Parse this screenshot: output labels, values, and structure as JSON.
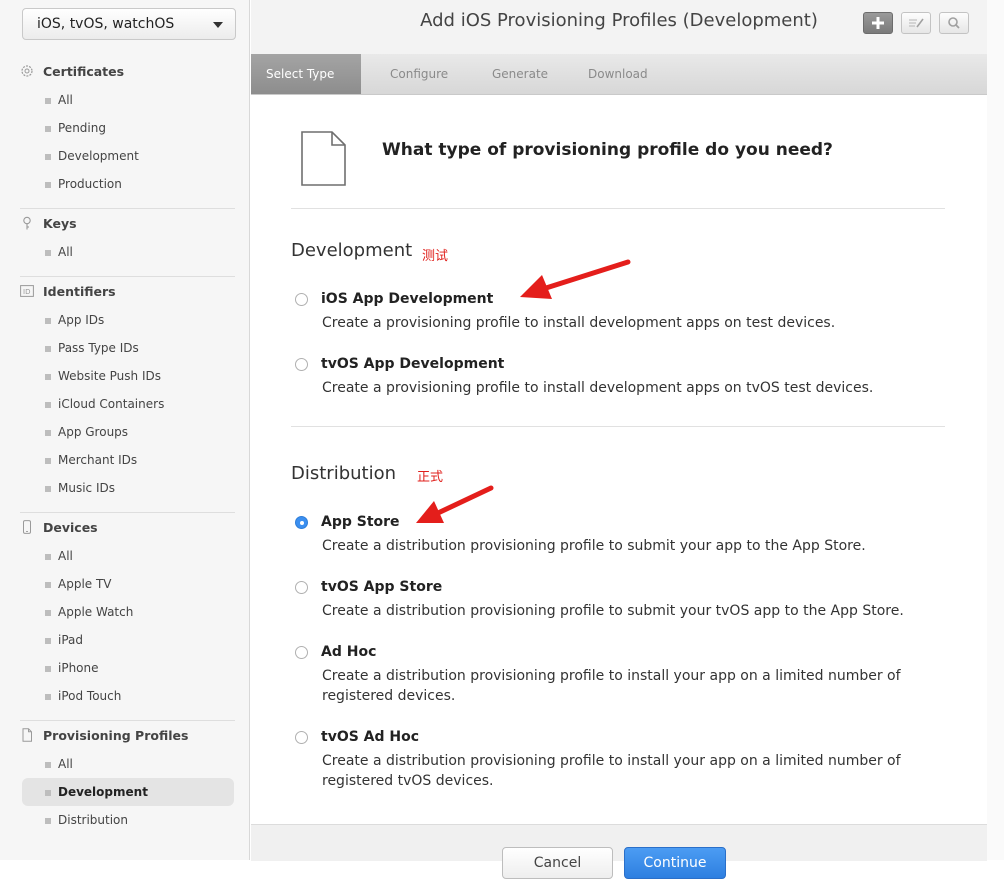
{
  "platform": {
    "selected": "iOS, tvOS, watchOS"
  },
  "sidebar": {
    "sections": [
      {
        "title": "Certificates",
        "icon": "gear-icon",
        "items": [
          "All",
          "Pending",
          "Development",
          "Production"
        ]
      },
      {
        "title": "Keys",
        "icon": "key-icon",
        "items": [
          "All"
        ]
      },
      {
        "title": "Identifiers",
        "icon": "id-icon",
        "items": [
          "App IDs",
          "Pass Type IDs",
          "Website Push IDs",
          "iCloud Containers",
          "App Groups",
          "Merchant IDs",
          "Music IDs"
        ]
      },
      {
        "title": "Devices",
        "icon": "device-icon",
        "items": [
          "All",
          "Apple TV",
          "Apple Watch",
          "iPad",
          "iPhone",
          "iPod Touch"
        ]
      },
      {
        "title": "Provisioning Profiles",
        "icon": "document-icon",
        "items": [
          "All",
          "Development",
          "Distribution"
        ],
        "active": "Development"
      }
    ]
  },
  "header": {
    "title": "Add iOS Provisioning Profiles (Development)"
  },
  "steps": [
    "Select Type",
    "Configure",
    "Generate",
    "Download"
  ],
  "main": {
    "question": "What type of provisioning profile do you need?",
    "groups": [
      {
        "title": "Development",
        "annotation": "测试",
        "options": [
          {
            "title": "iOS App Development",
            "desc": "Create a provisioning profile to install development apps on test devices.",
            "checked": false
          },
          {
            "title": "tvOS App Development",
            "desc": "Create a provisioning profile to install development apps on tvOS test devices.",
            "checked": false
          }
        ]
      },
      {
        "title": "Distribution",
        "annotation": "正式",
        "options": [
          {
            "title": "App Store",
            "desc": "Create a distribution provisioning profile to submit your app to the App Store.",
            "checked": true
          },
          {
            "title": "tvOS App Store",
            "desc": "Create a distribution provisioning profile to submit your tvOS app to the App Store.",
            "checked": false
          },
          {
            "title": "Ad Hoc",
            "desc": "Create a distribution provisioning profile to install your app on a limited number of registered devices.",
            "checked": false
          },
          {
            "title": "tvOS Ad Hoc",
            "desc": "Create a distribution provisioning profile to install your app on a limited number of registered tvOS devices.",
            "checked": false
          }
        ]
      }
    ]
  },
  "footer": {
    "cancel": "Cancel",
    "continue": "Continue"
  },
  "colors": {
    "annotation": "#e0201c",
    "accent": "#2d7fe0"
  }
}
